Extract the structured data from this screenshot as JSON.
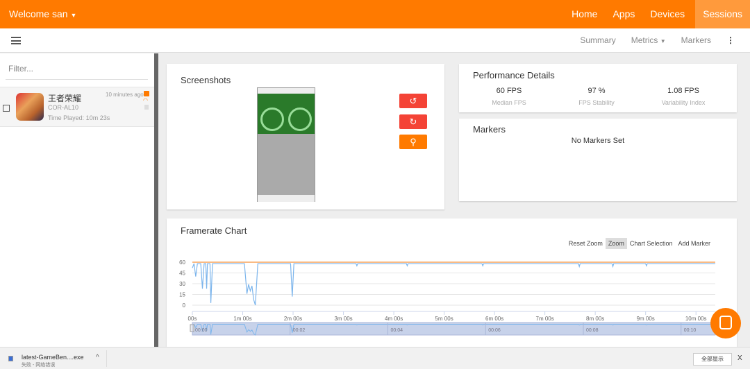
{
  "header": {
    "welcome": "Welcome san",
    "nav": [
      "Home",
      "Apps",
      "Devices",
      "Sessions"
    ],
    "active": "Sessions",
    "accent": "#ff7a00"
  },
  "toolbar": {
    "items": [
      "Summary",
      "Metrics",
      "Markers"
    ]
  },
  "sidebar": {
    "filter_placeholder": "Filter...",
    "sessions": [
      {
        "app": "王者荣耀",
        "device": "COR-AL10",
        "time_played": "Time Played: 10m 23s",
        "ago": "10 minutes ago"
      }
    ]
  },
  "screenshots": {
    "title": "Screenshots",
    "buttons": [
      "rotate-left-icon",
      "rotate-right-icon",
      "zoom-in-icon"
    ]
  },
  "performance": {
    "title": "Performance Details",
    "metrics": [
      {
        "value": "60 FPS",
        "label": "Median FPS"
      },
      {
        "value": "97 %",
        "label": "FPS Stability"
      },
      {
        "value": "1.08 FPS",
        "label": "Variability Index"
      }
    ]
  },
  "markers": {
    "title": "Markers",
    "empty": "No Markers Set"
  },
  "framerate": {
    "title": "Framerate Chart",
    "tools": [
      "Reset Zoom",
      "Zoom",
      "Chart Selection",
      "Add Marker"
    ],
    "selected_tool": "Zoom"
  },
  "chart_data": {
    "type": "line",
    "xlim": [
      0,
      623
    ],
    "ylim": [
      0,
      60
    ],
    "yticks": [
      "0",
      "15",
      "30",
      "45",
      "60"
    ],
    "xticks": [
      "00s",
      "1m 00s",
      "2m 00s",
      "3m 00s",
      "4m 00s",
      "5m 00s",
      "6m 00s",
      "7m 00s",
      "8m 00s",
      "9m 00s",
      "10m 00s"
    ],
    "navigator_ticks": [
      "00:00",
      "00:02",
      "00:04",
      "00:06",
      "00:08",
      "00:10"
    ],
    "target_line": 60,
    "colors": {
      "fps": "#7cb5ec",
      "target": "#f7a35c"
    },
    "series": [
      {
        "points": [
          [
            0,
            52
          ],
          [
            2,
            58
          ],
          [
            4,
            40
          ],
          [
            6,
            58
          ],
          [
            10,
            58
          ],
          [
            12,
            23
          ],
          [
            14,
            58
          ],
          [
            16,
            58
          ],
          [
            17,
            23
          ],
          [
            18,
            58
          ],
          [
            21,
            58
          ],
          [
            22,
            3
          ],
          [
            24,
            58
          ],
          [
            60,
            58
          ],
          [
            62,
            58
          ],
          [
            65,
            16
          ],
          [
            67,
            29
          ],
          [
            69,
            20
          ],
          [
            71,
            27
          ],
          [
            73,
            8
          ],
          [
            75,
            0
          ],
          [
            78,
            58
          ],
          [
            117,
            58
          ],
          [
            119,
            12
          ],
          [
            121,
            58
          ],
          [
            195,
            58
          ],
          [
            196,
            55
          ],
          [
            197,
            58
          ],
          [
            255,
            58
          ],
          [
            256,
            55
          ],
          [
            257,
            58
          ],
          [
            345,
            58
          ],
          [
            346,
            55
          ],
          [
            347,
            58
          ],
          [
            460,
            58
          ],
          [
            461,
            54
          ],
          [
            462,
            58
          ],
          [
            500,
            58
          ],
          [
            501,
            54
          ],
          [
            502,
            58
          ],
          [
            540,
            58
          ],
          [
            541,
            55
          ],
          [
            542,
            58
          ],
          [
            623,
            58
          ]
        ]
      }
    ]
  },
  "download": {
    "file": "latest-GameBen....exe",
    "status": "失败 - 网络错误",
    "show_all": "全部显示",
    "close": "X"
  }
}
